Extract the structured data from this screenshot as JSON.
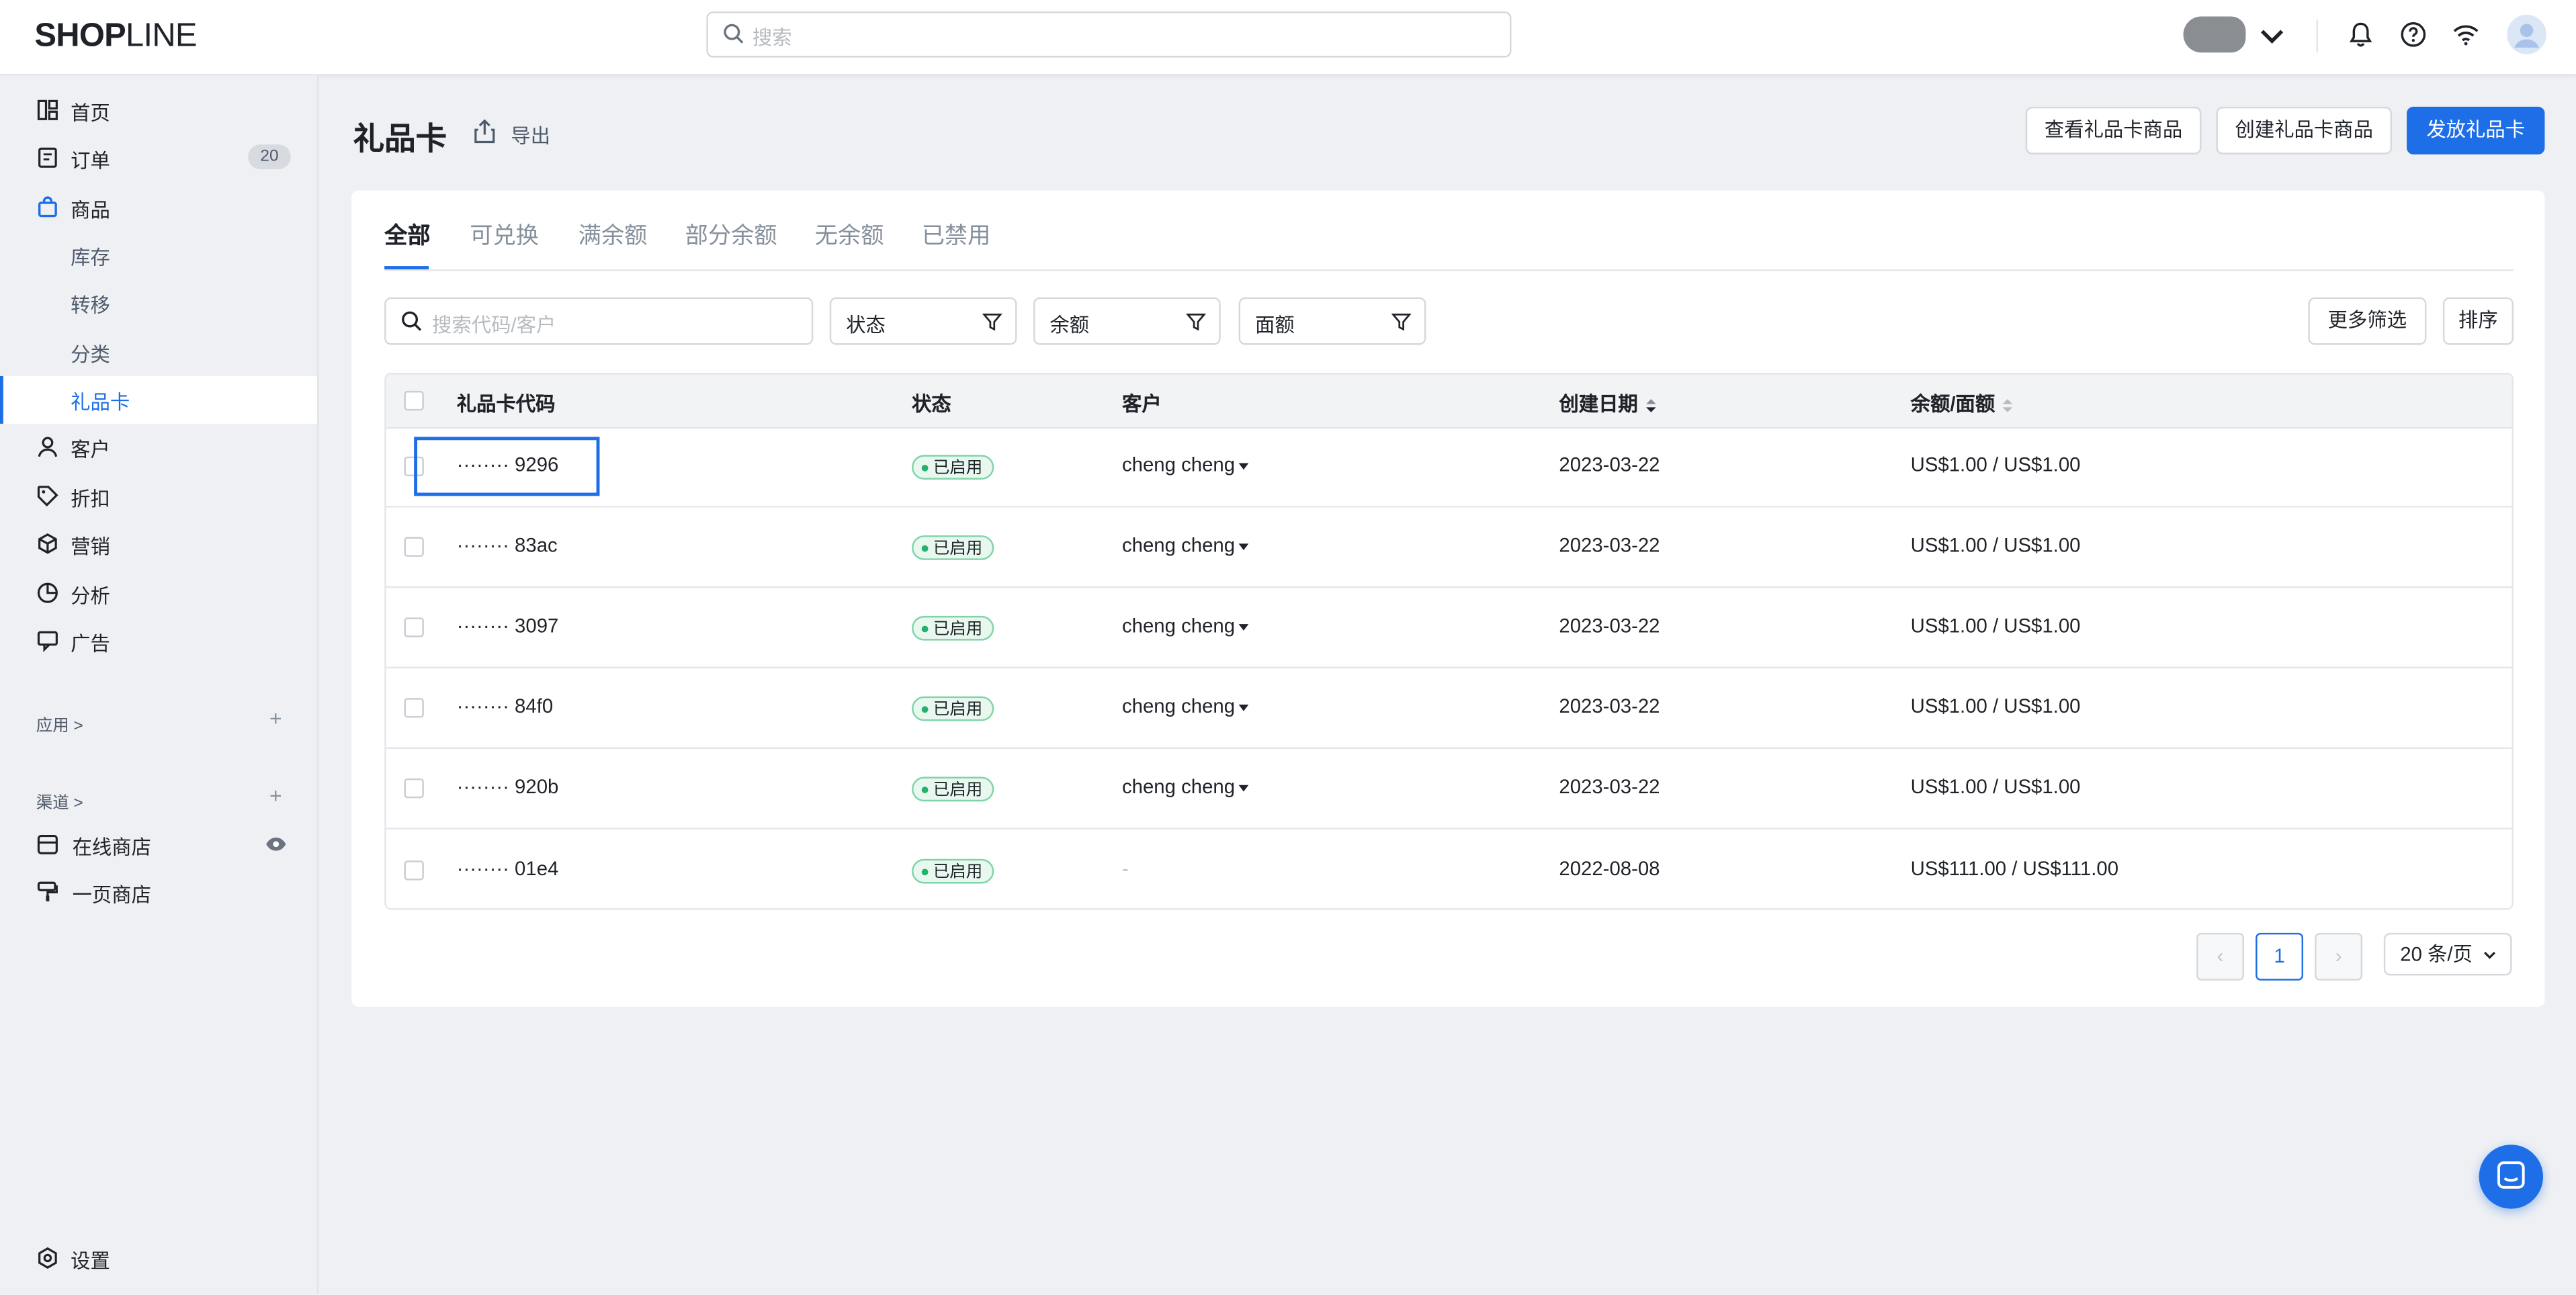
{
  "header": {
    "logo_bold": "SHOP",
    "logo_light": "LINE",
    "search_placeholder": "搜索"
  },
  "sidebar": {
    "items": [
      {
        "label": "首页",
        "icon": "dashboard-icon"
      },
      {
        "label": "订单",
        "icon": "order-icon",
        "badge": "20"
      },
      {
        "label": "商品",
        "icon": "bag-icon"
      },
      {
        "label": "库存"
      },
      {
        "label": "转移"
      },
      {
        "label": "分类"
      },
      {
        "label": "礼品卡"
      },
      {
        "label": "客户",
        "icon": "person-icon"
      },
      {
        "label": "折扣",
        "icon": "tag-icon"
      },
      {
        "label": "营销",
        "icon": "cube-icon"
      },
      {
        "label": "分析",
        "icon": "pie-icon"
      },
      {
        "label": "广告",
        "icon": "ad-icon"
      }
    ],
    "apps_label": "应用 >",
    "channels_label": "渠道 >",
    "channels": [
      {
        "label": "在线商店",
        "icon": "store-icon"
      },
      {
        "label": "一页商店",
        "icon": "roller-icon"
      }
    ],
    "settings_label": "设置"
  },
  "page": {
    "title": "礼品卡",
    "export_label": "导出",
    "buttons": {
      "view_products": "查看礼品卡商品",
      "create_product": "创建礼品卡商品",
      "issue": "发放礼品卡"
    },
    "tabs": [
      "全部",
      "可兑换",
      "满余额",
      "部分余额",
      "无余额",
      "已禁用"
    ],
    "filters": {
      "search_placeholder": "搜索代码/客户",
      "status": "状态",
      "balance": "余额",
      "face_value": "面额",
      "more": "更多筛选",
      "sort": "排序"
    },
    "table": {
      "headers": [
        "礼品卡代码",
        "状态",
        "客户",
        "创建日期",
        "余额/面额"
      ],
      "rows": [
        {
          "code": "········ 9296",
          "status": "已启用",
          "customer": "cheng cheng",
          "date": "2023-03-22",
          "balance": "US$1.00 / US$1.00"
        },
        {
          "code": "········ 83ac",
          "status": "已启用",
          "customer": "cheng cheng",
          "date": "2023-03-22",
          "balance": "US$1.00 / US$1.00"
        },
        {
          "code": "········ 3097",
          "status": "已启用",
          "customer": "cheng cheng",
          "date": "2023-03-22",
          "balance": "US$1.00 / US$1.00"
        },
        {
          "code": "········ 84f0",
          "status": "已启用",
          "customer": "cheng cheng",
          "date": "2023-03-22",
          "balance": "US$1.00 / US$1.00"
        },
        {
          "code": "········ 920b",
          "status": "已启用",
          "customer": "cheng cheng",
          "date": "2023-03-22",
          "balance": "US$1.00 / US$1.00"
        },
        {
          "code": "········ 01e4",
          "status": "已启用",
          "customer": "-",
          "date": "2022-08-08",
          "balance": "US$111.00 / US$111.00"
        }
      ]
    },
    "pagination": {
      "prev": "‹",
      "current": "1",
      "next": "›",
      "page_size": "20 条/页"
    }
  },
  "colors": {
    "accent": "#1d6ee7",
    "status_green": "#23b26b"
  }
}
